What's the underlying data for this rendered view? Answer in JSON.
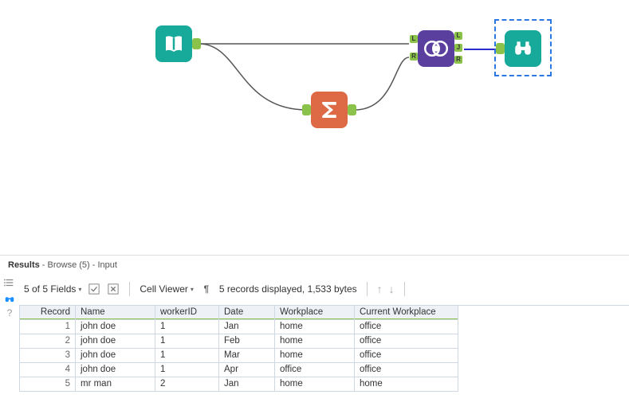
{
  "canvas": {
    "nodes": {
      "input": {
        "label": "Input Data"
      },
      "summarize": {
        "label": "Summarize"
      },
      "join": {
        "label": "Join"
      },
      "browse": {
        "label": "Browse"
      },
      "join_badges": {
        "L": "L",
        "J": "J",
        "R": "R"
      }
    }
  },
  "results": {
    "title_prefix": "Results",
    "title_suffix": " - Browse (5) - Input"
  },
  "toolbar": {
    "fields_label": "5 of 5 Fields",
    "cell_viewer_label": "Cell Viewer",
    "status_text": "5 records displayed, 1,533 bytes"
  },
  "table": {
    "columns": [
      "Record",
      "Name",
      "workerID",
      "Date",
      "Workplace",
      "Current Workplace"
    ],
    "rows": [
      {
        "Record": "1",
        "Name": "john doe",
        "workerID": "1",
        "Date": "Jan",
        "Workplace": "home",
        "Current Workplace": "office"
      },
      {
        "Record": "2",
        "Name": "john doe",
        "workerID": "1",
        "Date": "Feb",
        "Workplace": "home",
        "Current Workplace": "office"
      },
      {
        "Record": "3",
        "Name": "john doe",
        "workerID": "1",
        "Date": "Mar",
        "Workplace": "home",
        "Current Workplace": "office"
      },
      {
        "Record": "4",
        "Name": "john doe",
        "workerID": "1",
        "Date": "Apr",
        "Workplace": "office",
        "Current Workplace": "office"
      },
      {
        "Record": "5",
        "Name": "mr man",
        "workerID": "2",
        "Date": "Jan",
        "Workplace": "home",
        "Current Workplace": "home"
      }
    ]
  }
}
